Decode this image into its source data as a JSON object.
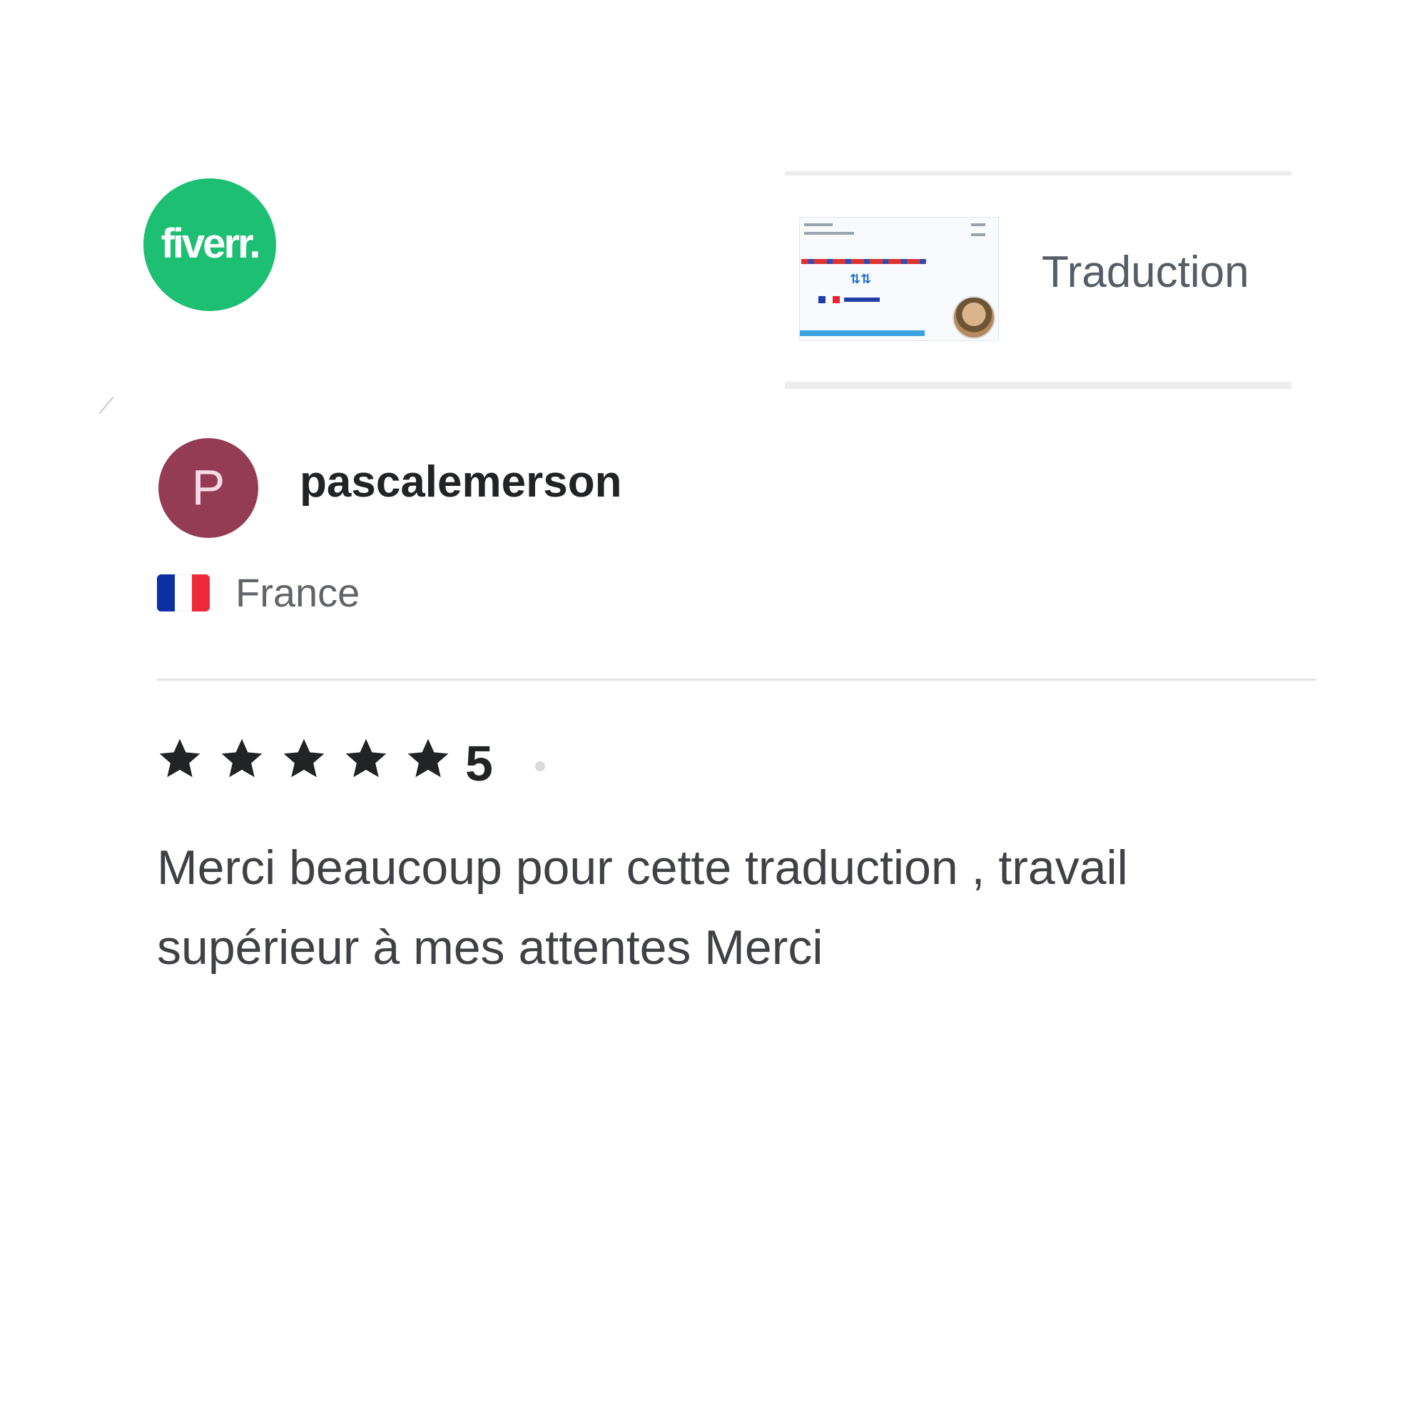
{
  "logo": {
    "text": "fiverr.",
    "color": "#1dbf73"
  },
  "gig": {
    "title": "Traduction"
  },
  "reviewer": {
    "initial": "P",
    "username": "pascalemerson",
    "country": "France",
    "avatar_color": "#953c55"
  },
  "review": {
    "rating": "5",
    "stars_filled": 5,
    "stars_total": 5,
    "text": "Merci beaucoup pour cette traduction , travail supérieur à mes attentes Merci"
  }
}
